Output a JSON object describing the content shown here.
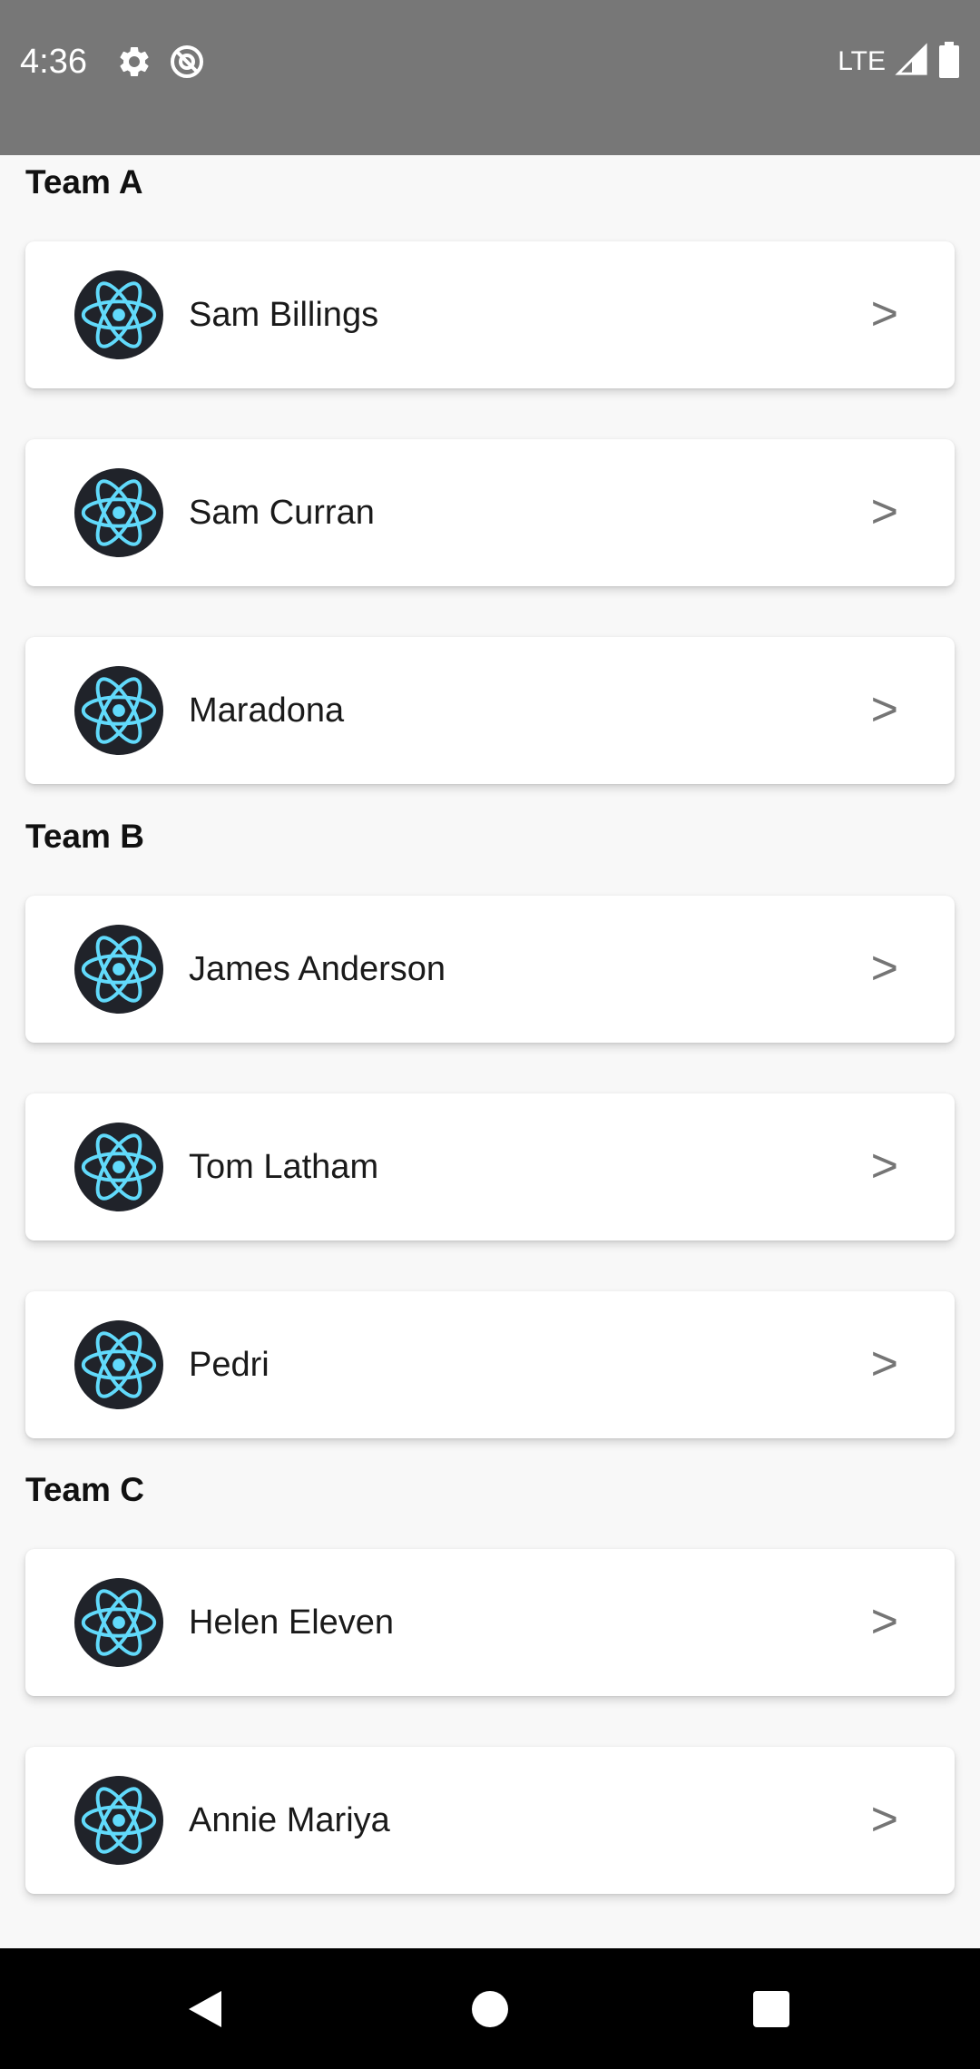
{
  "status_bar": {
    "time": "4:36",
    "icons": [
      "gear-icon",
      "do-not-disturb-icon"
    ],
    "network": "LTE",
    "right_icons": [
      "signal-icon",
      "battery-icon"
    ]
  },
  "sections": [
    {
      "title": "Team A",
      "members": [
        {
          "name": "Sam Billings",
          "chevron": ">"
        },
        {
          "name": "Sam Curran",
          "chevron": ">"
        },
        {
          "name": "Maradona",
          "chevron": ">"
        }
      ]
    },
    {
      "title": "Team B",
      "members": [
        {
          "name": "James Anderson",
          "chevron": ">"
        },
        {
          "name": "Tom Latham",
          "chevron": ">"
        },
        {
          "name": "Pedri",
          "chevron": ">"
        }
      ]
    },
    {
      "title": "Team C",
      "members": [
        {
          "name": "Helen Eleven",
          "chevron": ">"
        },
        {
          "name": "Annie Mariya",
          "chevron": ">"
        }
      ]
    }
  ],
  "nav_bar": {
    "buttons": [
      "back-icon",
      "home-icon",
      "recents-icon"
    ]
  },
  "colors": {
    "status_bar": "#777777",
    "background": "#f8f8f8",
    "card": "#ffffff",
    "avatar_bg": "#20232a",
    "react_blue": "#61dafb",
    "chevron": "#757575"
  }
}
